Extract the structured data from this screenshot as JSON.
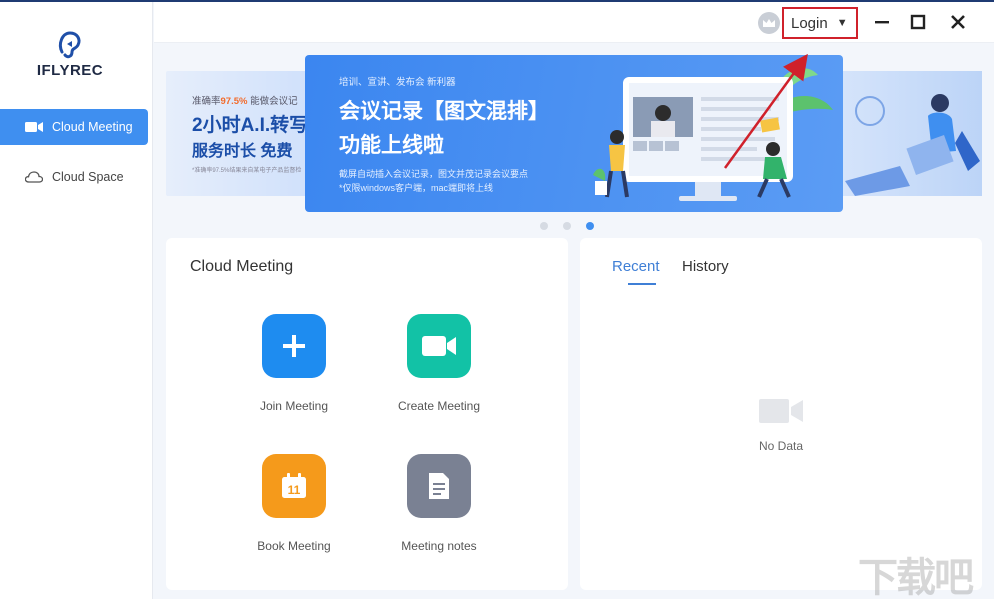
{
  "app": {
    "name": "IFLYREC"
  },
  "sidebar": {
    "items": [
      {
        "label": "Cloud Meeting",
        "icon": "video-camera-icon",
        "active": true
      },
      {
        "label": "Cloud Space",
        "icon": "cloud-icon",
        "active": false
      }
    ]
  },
  "header": {
    "login_label": "Login",
    "caret": "▼",
    "minimize_icon": "minimize-icon",
    "maximize_icon": "maximize-icon",
    "close_icon": "close-icon"
  },
  "banner_left": {
    "line1_prefix": "准确率",
    "line1_highlight": "97.5%",
    "line1_suffix": "能做会议记",
    "line2": "2小时A.I.转写",
    "line3": "服务时长 免费",
    "line4": "*准确率97.5%结果来自某电子产品监督检"
  },
  "banner": {
    "subtitle": "培训、宣讲、发布会 新利器",
    "title_line1": "会议记录【图文混排】",
    "title_line2": "功能上线啦",
    "desc_line1": "截屏自动插入会议记录，图文并茂记录会议要点",
    "desc_line2": "*仅限windows客户端，mac端即将上线"
  },
  "carousel": {
    "count": 3,
    "active_index": 2
  },
  "meeting_card": {
    "title": "Cloud Meeting",
    "actions": [
      {
        "label": "Join Meeting",
        "icon": "plus-icon",
        "color": "#1e8cf0"
      },
      {
        "label": "Create Meeting",
        "icon": "video-camera-icon",
        "color": "#12c2a6"
      },
      {
        "label": "Book Meeting",
        "icon": "calendar-icon",
        "color": "#f59a1b",
        "icon_text": "11"
      },
      {
        "label": "Meeting notes",
        "icon": "document-icon",
        "color": "#7a8193"
      }
    ]
  },
  "records_card": {
    "tabs": [
      {
        "label": "Recent",
        "active": true
      },
      {
        "label": "History",
        "active": false
      }
    ],
    "empty_label": "No Data"
  },
  "watermark": {
    "text": "下载吧"
  },
  "colors": {
    "accent": "#3f8ff0",
    "highlight_box": "#d0212b",
    "annotation_arrow": "#d0212b"
  }
}
